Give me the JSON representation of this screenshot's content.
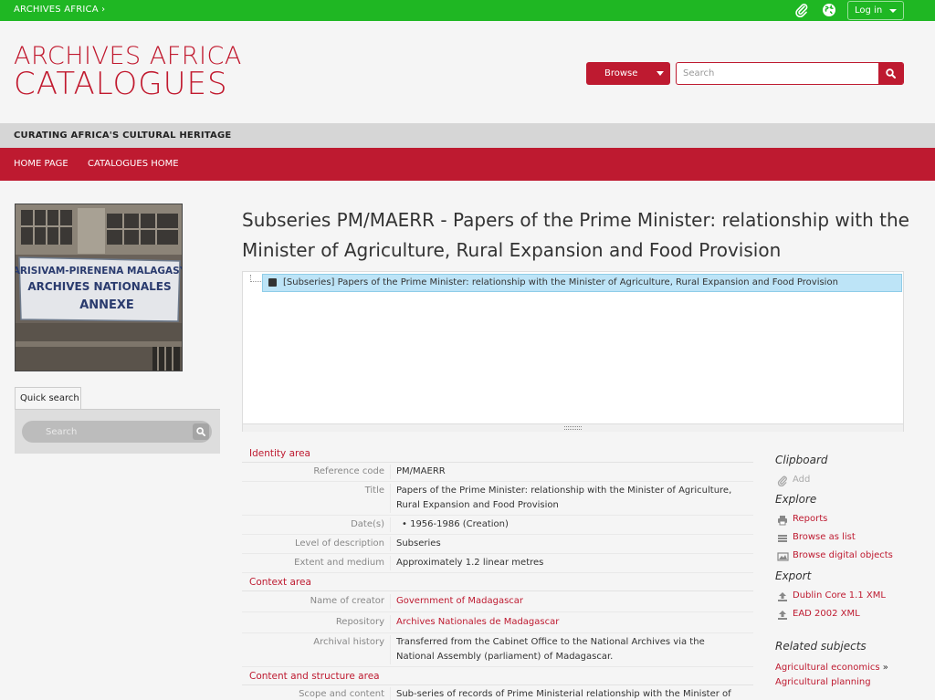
{
  "topbar": {
    "brand": "ARCHIVES AFRICA ›",
    "login": "Log in"
  },
  "header": {
    "logo_line1": "ARCHIVES AFRICA",
    "logo_line2": "CATALOGUES",
    "browse": "Browse",
    "search_placeholder": "Search"
  },
  "tagline": "CURATING AFRICA'S CULTURAL HERITAGE",
  "nav": [
    "HOME PAGE",
    "CATALOGUES HOME"
  ],
  "photo": {
    "sign_line1": "ARISIVAM-PIRENENA MALAGASY",
    "sign_line2": "ARCHIVES NATIONALES",
    "sign_line3": "ANNEXE"
  },
  "quick_search": {
    "tab": "Quick search",
    "placeholder": "Search"
  },
  "page_title": "Subseries PM/MAERR - Papers of the Prime Minister: relationship with the Minister of Agriculture, Rural Expansion and Food Provision",
  "tree": {
    "node": "[Subseries] Papers of the Prime Minister: relationship with the Minister of Agriculture, Rural Expansion and Food Provision"
  },
  "identity": {
    "heading": "Identity area",
    "reference_code_label": "Reference code",
    "reference_code": "PM/MAERR",
    "title_label": "Title",
    "title": "Papers of the Prime Minister: relationship with the Minister of Agriculture, Rural Expansion and Food Provision",
    "dates_label": "Date(s)",
    "dates": "1956-1986 (Creation)",
    "level_label": "Level of description",
    "level": "Subseries",
    "extent_label": "Extent and medium",
    "extent": "Approximately 1.2 linear metres"
  },
  "context": {
    "heading": "Context area",
    "creator_label": "Name of creator",
    "creator": "Government of Madagascar",
    "repository_label": "Repository",
    "repository": "Archives Nationales de Madagascar",
    "history_label": "Archival history",
    "history": "Transferred from the Cabinet Office to the National Archives via the National Assembly (parliament) of Madagascar."
  },
  "content": {
    "heading": "Content and structure area",
    "scope_label": "Scope and content",
    "scope": "Sub-series of records of Prime Ministerial relationship with the Minister of"
  },
  "sidebar_right": {
    "clipboard": "Clipboard",
    "add": "Add",
    "explore": "Explore",
    "reports": "Reports",
    "browse_list": "Browse as list",
    "browse_digital": "Browse digital objects",
    "export": "Export",
    "dublin_core": "Dublin Core 1.1 XML",
    "ead": "EAD 2002 XML",
    "related_subjects": "Related subjects",
    "subject1": "Agricultural economics",
    "subject1_tail": " »",
    "subject2": "Agricultural planning"
  },
  "colors": {
    "green": "#1fb723",
    "red": "#be1a30"
  }
}
